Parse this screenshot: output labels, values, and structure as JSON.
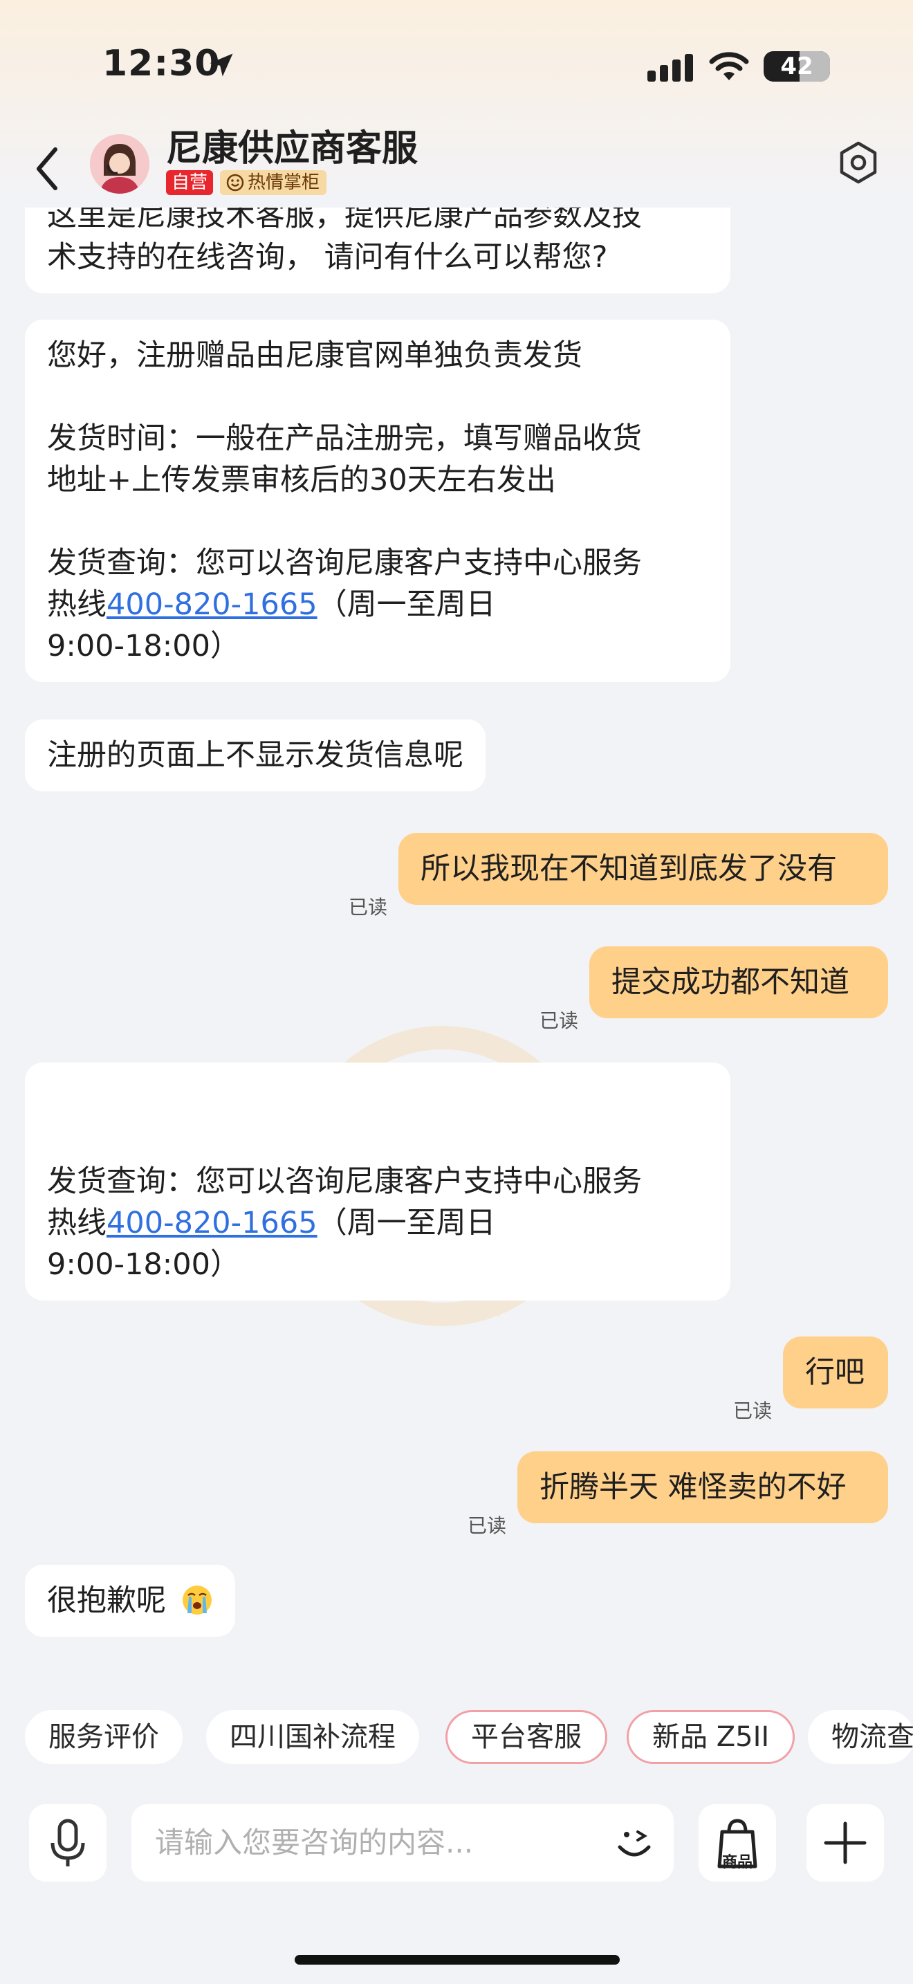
{
  "status_bar": {
    "time": "12:30",
    "battery": "42"
  },
  "header": {
    "title": "尼康供应商客服",
    "tag_self": "自营",
    "tag_hot": "热情掌柜"
  },
  "messages": {
    "m0_line1": "这里是尼康技术客服，提供尼康产品参数及技",
    "m0_line2": "术支持的在线咨询， 请问有什么可以帮您?",
    "m1_line1": "您好，注册赠品由尼康官网单独负责发货",
    "m1_line2": "发货时间：一般在产品注册完，填写赠品收货",
    "m1_line3": "地址+上传发票审核后的30天左右发出",
    "m1_line4": "发货查询：您可以咨询尼康客户支持中心服务",
    "m1_hotline_prefix": "热线",
    "m1_phone": "400-820-1665",
    "m1_hours_a": "（周一至周日",
    "m1_hours_b": "9:00-18:00）",
    "m2": "注册的页面上不显示发货信息呢",
    "m3": "所以我现在不知道到底发了没有",
    "m4": "提交成功都不知道",
    "m5_line1": "发货查询：您可以咨询尼康客户支持中心服务",
    "m5_hotline_prefix": "热线",
    "m5_phone": "400-820-1665",
    "m5_hours_a": "（周一至周日",
    "m5_hours_b": "9:00-18:00）",
    "m6": "行吧",
    "m7": "折腾半天 难怪卖的不好",
    "m8": "很抱歉呢",
    "read_label": "已读"
  },
  "quick_replies": [
    "服务评价",
    "四川国补流程",
    "平台客服",
    "新品 Z5II",
    "物流查"
  ],
  "input": {
    "placeholder": "请输入您要咨询的内容...",
    "goods_label": "商品"
  },
  "colors": {
    "user_bubble": "#ffd08a",
    "link": "#2f6fe0",
    "tag_self": "#e8262d",
    "chip_highlight_border": "#f1a0a6"
  }
}
